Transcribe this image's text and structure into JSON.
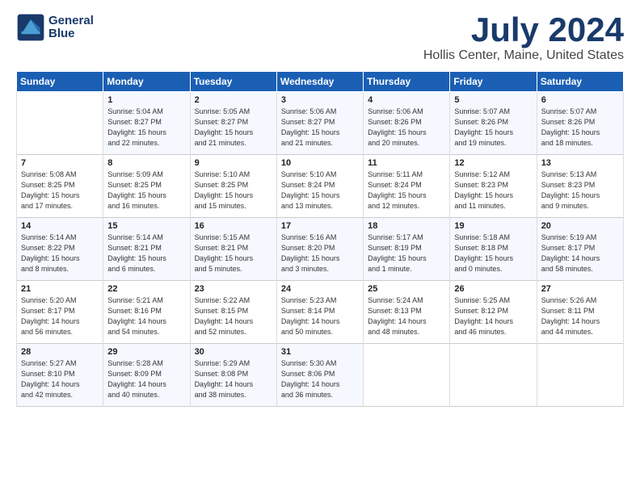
{
  "header": {
    "logo_line1": "General",
    "logo_line2": "Blue",
    "month": "July 2024",
    "location": "Hollis Center, Maine, United States"
  },
  "weekdays": [
    "Sunday",
    "Monday",
    "Tuesday",
    "Wednesday",
    "Thursday",
    "Friday",
    "Saturday"
  ],
  "weeks": [
    [
      {
        "day": "",
        "info": ""
      },
      {
        "day": "1",
        "info": "Sunrise: 5:04 AM\nSunset: 8:27 PM\nDaylight: 15 hours\nand 22 minutes."
      },
      {
        "day": "2",
        "info": "Sunrise: 5:05 AM\nSunset: 8:27 PM\nDaylight: 15 hours\nand 21 minutes."
      },
      {
        "day": "3",
        "info": "Sunrise: 5:06 AM\nSunset: 8:27 PM\nDaylight: 15 hours\nand 21 minutes."
      },
      {
        "day": "4",
        "info": "Sunrise: 5:06 AM\nSunset: 8:26 PM\nDaylight: 15 hours\nand 20 minutes."
      },
      {
        "day": "5",
        "info": "Sunrise: 5:07 AM\nSunset: 8:26 PM\nDaylight: 15 hours\nand 19 minutes."
      },
      {
        "day": "6",
        "info": "Sunrise: 5:07 AM\nSunset: 8:26 PM\nDaylight: 15 hours\nand 18 minutes."
      }
    ],
    [
      {
        "day": "7",
        "info": "Sunrise: 5:08 AM\nSunset: 8:25 PM\nDaylight: 15 hours\nand 17 minutes."
      },
      {
        "day": "8",
        "info": "Sunrise: 5:09 AM\nSunset: 8:25 PM\nDaylight: 15 hours\nand 16 minutes."
      },
      {
        "day": "9",
        "info": "Sunrise: 5:10 AM\nSunset: 8:25 PM\nDaylight: 15 hours\nand 15 minutes."
      },
      {
        "day": "10",
        "info": "Sunrise: 5:10 AM\nSunset: 8:24 PM\nDaylight: 15 hours\nand 13 minutes."
      },
      {
        "day": "11",
        "info": "Sunrise: 5:11 AM\nSunset: 8:24 PM\nDaylight: 15 hours\nand 12 minutes."
      },
      {
        "day": "12",
        "info": "Sunrise: 5:12 AM\nSunset: 8:23 PM\nDaylight: 15 hours\nand 11 minutes."
      },
      {
        "day": "13",
        "info": "Sunrise: 5:13 AM\nSunset: 8:23 PM\nDaylight: 15 hours\nand 9 minutes."
      }
    ],
    [
      {
        "day": "14",
        "info": "Sunrise: 5:14 AM\nSunset: 8:22 PM\nDaylight: 15 hours\nand 8 minutes."
      },
      {
        "day": "15",
        "info": "Sunrise: 5:14 AM\nSunset: 8:21 PM\nDaylight: 15 hours\nand 6 minutes."
      },
      {
        "day": "16",
        "info": "Sunrise: 5:15 AM\nSunset: 8:21 PM\nDaylight: 15 hours\nand 5 minutes."
      },
      {
        "day": "17",
        "info": "Sunrise: 5:16 AM\nSunset: 8:20 PM\nDaylight: 15 hours\nand 3 minutes."
      },
      {
        "day": "18",
        "info": "Sunrise: 5:17 AM\nSunset: 8:19 PM\nDaylight: 15 hours\nand 1 minute."
      },
      {
        "day": "19",
        "info": "Sunrise: 5:18 AM\nSunset: 8:18 PM\nDaylight: 15 hours\nand 0 minutes."
      },
      {
        "day": "20",
        "info": "Sunrise: 5:19 AM\nSunset: 8:17 PM\nDaylight: 14 hours\nand 58 minutes."
      }
    ],
    [
      {
        "day": "21",
        "info": "Sunrise: 5:20 AM\nSunset: 8:17 PM\nDaylight: 14 hours\nand 56 minutes."
      },
      {
        "day": "22",
        "info": "Sunrise: 5:21 AM\nSunset: 8:16 PM\nDaylight: 14 hours\nand 54 minutes."
      },
      {
        "day": "23",
        "info": "Sunrise: 5:22 AM\nSunset: 8:15 PM\nDaylight: 14 hours\nand 52 minutes."
      },
      {
        "day": "24",
        "info": "Sunrise: 5:23 AM\nSunset: 8:14 PM\nDaylight: 14 hours\nand 50 minutes."
      },
      {
        "day": "25",
        "info": "Sunrise: 5:24 AM\nSunset: 8:13 PM\nDaylight: 14 hours\nand 48 minutes."
      },
      {
        "day": "26",
        "info": "Sunrise: 5:25 AM\nSunset: 8:12 PM\nDaylight: 14 hours\nand 46 minutes."
      },
      {
        "day": "27",
        "info": "Sunrise: 5:26 AM\nSunset: 8:11 PM\nDaylight: 14 hours\nand 44 minutes."
      }
    ],
    [
      {
        "day": "28",
        "info": "Sunrise: 5:27 AM\nSunset: 8:10 PM\nDaylight: 14 hours\nand 42 minutes."
      },
      {
        "day": "29",
        "info": "Sunrise: 5:28 AM\nSunset: 8:09 PM\nDaylight: 14 hours\nand 40 minutes."
      },
      {
        "day": "30",
        "info": "Sunrise: 5:29 AM\nSunset: 8:08 PM\nDaylight: 14 hours\nand 38 minutes."
      },
      {
        "day": "31",
        "info": "Sunrise: 5:30 AM\nSunset: 8:06 PM\nDaylight: 14 hours\nand 36 minutes."
      },
      {
        "day": "",
        "info": ""
      },
      {
        "day": "",
        "info": ""
      },
      {
        "day": "",
        "info": ""
      }
    ]
  ]
}
